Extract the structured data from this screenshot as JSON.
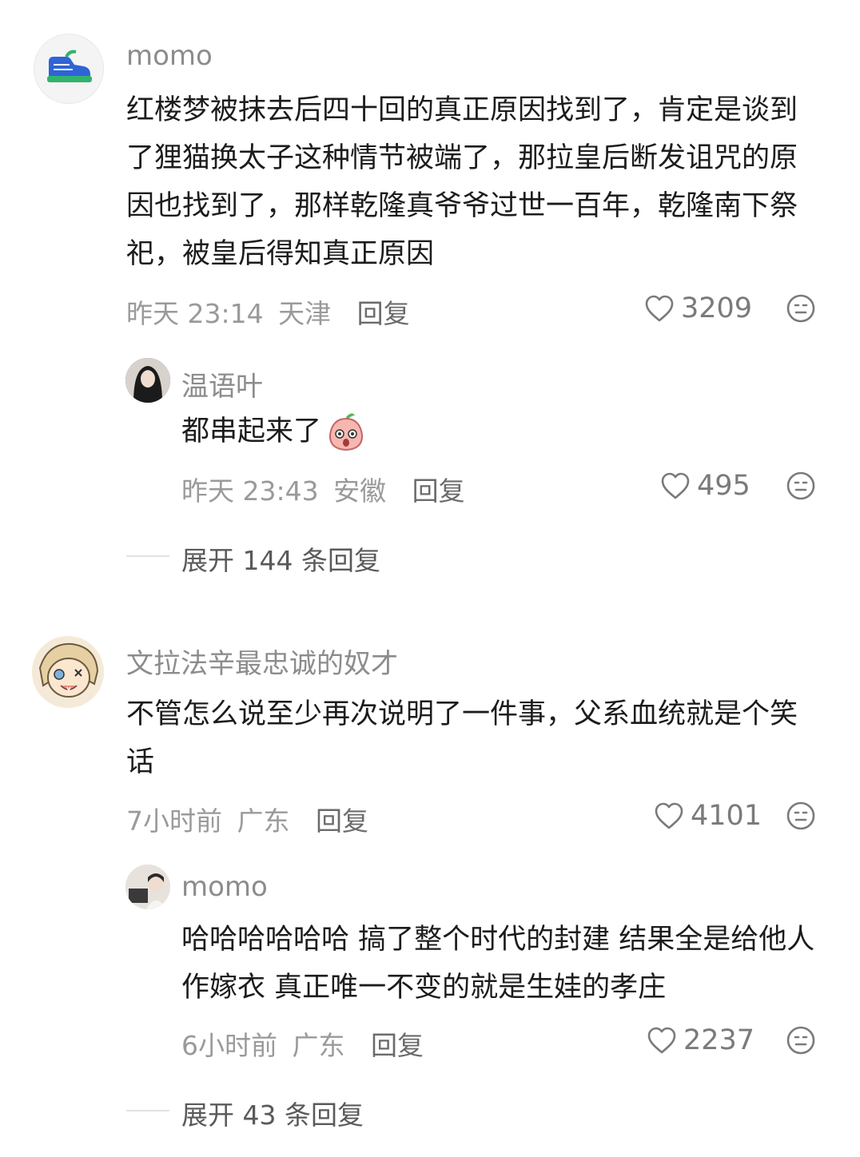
{
  "comments": [
    {
      "username": "momo",
      "text": "红楼梦被抹去后四十回的真正原因找到了，肯定是谈到了狸猫换太子这种情节被端了，那拉皇后断发诅咒的原因也找到了，那样乾隆真爷爷过世一百年，乾隆南下祭祀，被皇后得知真正原因",
      "time": "昨天 23:14",
      "location": "天津",
      "reply_label": "回复",
      "likes": "3209",
      "replies": [
        {
          "username": "温语叶",
          "text": "都串起来了",
          "time": "昨天 23:43",
          "location": "安徽",
          "reply_label": "回复",
          "likes": "495"
        }
      ],
      "expand_label": "展开 144 条回复"
    },
    {
      "username": "文拉法辛最忠诚的奴才",
      "text": "不管怎么说至少再次说明了一件事，父系血统就是个笑话",
      "time": "7小时前",
      "location": "广东",
      "reply_label": "回复",
      "likes": "4101",
      "replies": [
        {
          "username": "momo",
          "text": "哈哈哈哈哈哈 搞了整个时代的封建 结果全是给他人作嫁衣 真正唯一不变的就是生娃的孝庄",
          "time": "6小时前",
          "location": "广东",
          "reply_label": "回复",
          "likes": "2237"
        }
      ],
      "expand_label": "展开 43 条回复"
    }
  ],
  "icons": {
    "like": "heart-outline-icon",
    "emoji": "neutral-face-icon"
  },
  "colors": {
    "text_primary": "#1c1c1c",
    "text_secondary": "#9a9a9a",
    "username": "#8c8c8c"
  }
}
